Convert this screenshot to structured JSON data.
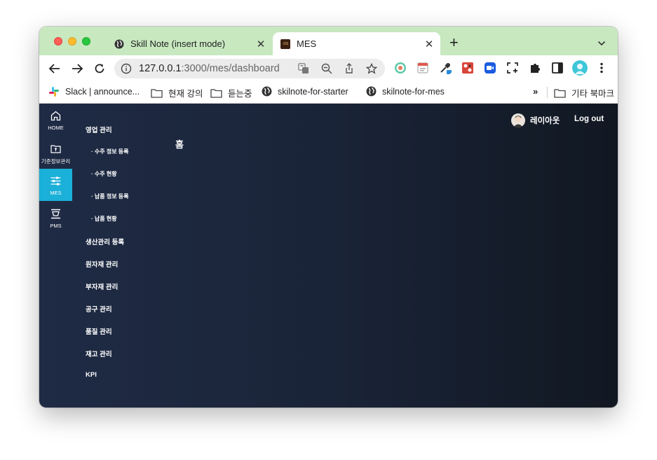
{
  "browser": {
    "tabs": [
      {
        "title": "Skill Note (insert mode)",
        "favicon": "globe-icon",
        "active": false
      },
      {
        "title": "MES",
        "favicon": "mes-logo-icon",
        "favicon_text": "-DS",
        "active": true
      }
    ],
    "close_glyph": "✕",
    "new_tab_glyph": "+",
    "tab_menu_glyph": "⌄",
    "url_host": "127.0.0.1",
    "url_path": ":3000/mes/dashboard",
    "bookmarks": [
      {
        "label": "Slack | announce...",
        "icon": "slack-icon"
      },
      {
        "label": "현재 강의",
        "icon": "folder-icon"
      },
      {
        "label": "듣는중",
        "icon": "folder-icon"
      },
      {
        "label": "skilnote-for-starter",
        "icon": "globe-icon"
      },
      {
        "label": "skilnote-for-mes",
        "icon": "globe-icon"
      }
    ],
    "bookmarks_overflow": "»",
    "other_bookmarks": "기타 북마크"
  },
  "app": {
    "rail": [
      {
        "label": "HOME",
        "icon": "home-icon",
        "active": false
      },
      {
        "label": "기준정보관리",
        "icon": "master-data-icon",
        "active": false
      },
      {
        "label": "MES",
        "icon": "sliders-icon",
        "active": true
      },
      {
        "label": "PMS",
        "icon": "pms-icon",
        "active": false
      }
    ],
    "menu": {
      "sales": "영업 관리",
      "sales_subs": [
        "· 수주 정보 등록",
        "· 수주 현황",
        "· 납품 정보 등록",
        "· 납품 현황"
      ],
      "items": [
        "생산관리 등록",
        "원자재 관리",
        "부자재 관리",
        "공구 관리",
        "품질 관리",
        "재고 관리",
        "KPI"
      ]
    },
    "page_title": "홈",
    "user_name": "레이아웃",
    "logout": "Log out",
    "colors": {
      "accent": "#1ab0d8",
      "background": "#1a2438",
      "tabstrip": "#c8e8c0"
    }
  }
}
